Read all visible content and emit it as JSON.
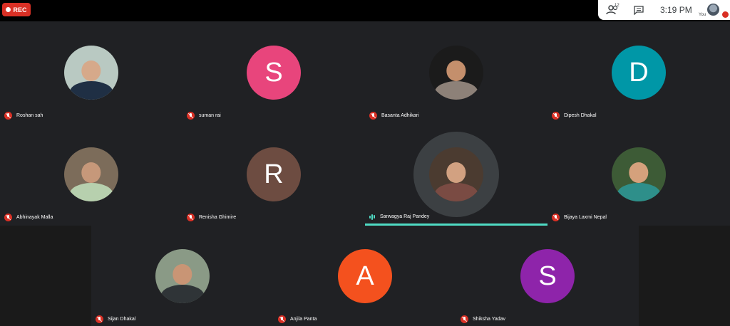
{
  "recording": {
    "label": "REC",
    "color": "#d93025"
  },
  "top_panel": {
    "participants_count": "12",
    "time": "3:19 PM",
    "self_label": "You",
    "icons": [
      "people-icon",
      "chat-icon"
    ]
  },
  "participants": [
    {
      "name": "Roshan sah",
      "avatar": "photo",
      "mic": "muted"
    },
    {
      "name": "suman rai",
      "avatar": "initial",
      "initial": "S",
      "color": "#e8457c",
      "mic": "muted"
    },
    {
      "name": "Basanta Adhikari",
      "avatar": "photo",
      "mic": "muted"
    },
    {
      "name": "Dipesh Dhakal",
      "avatar": "initial",
      "initial": "D",
      "color": "#0097a7",
      "mic": "muted"
    },
    {
      "name": "Abhinayak Malla",
      "avatar": "photo",
      "mic": "muted"
    },
    {
      "name": "Renisha Ghimire",
      "avatar": "initial",
      "initial": "R",
      "color": "#6d4c41",
      "mic": "muted"
    },
    {
      "name": "Sarwagya Raj Pandey",
      "avatar": "photo",
      "mic": "speaking"
    },
    {
      "name": "Bijaya Laxmi Nepal",
      "avatar": "photo",
      "mic": "muted"
    },
    {
      "name": "Sijan Dhakal",
      "avatar": "photo",
      "mic": "muted"
    },
    {
      "name": "Anjila Panta",
      "avatar": "initial",
      "initial": "A",
      "color": "#f4511e",
      "mic": "muted"
    },
    {
      "name": "Shiksha Yadav",
      "avatar": "initial",
      "initial": "S",
      "color": "#8e24aa",
      "mic": "muted"
    }
  ],
  "colors": {
    "background": "#202124",
    "speaking_accent": "#4fdbc4",
    "muted_red": "#d93025"
  }
}
